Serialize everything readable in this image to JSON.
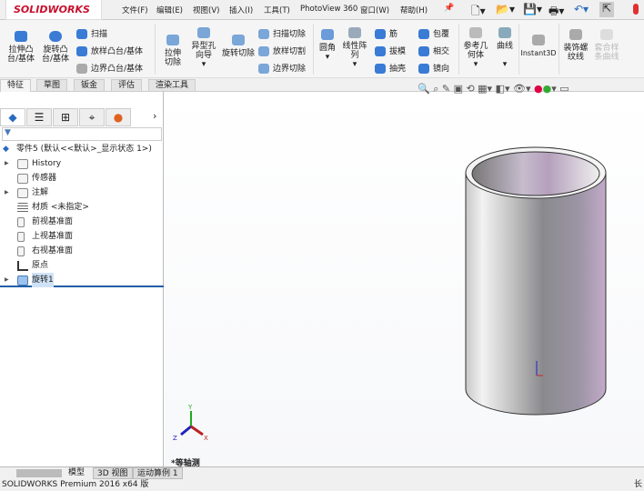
{
  "app": {
    "logo": "SOLIDWORKS"
  },
  "menu": [
    "文件(F)",
    "编辑(E)",
    "视图(V)",
    "插入(I)",
    "工具(T)",
    "PhotoView 360",
    "窗口(W)",
    "帮助(H)"
  ],
  "toolbar": {
    "extrude_boss": "拉伸凸台/基体",
    "revolve_boss": "旋转凸台/基体",
    "sweep": "扫描",
    "loft_boss": "放样凸台/基体",
    "boundary_boss": "边界凸台/基体",
    "extrude_cut": "拉伸切除",
    "hole_wizard": "异型孔向导",
    "revolve_cut": "旋转切除",
    "sweep_cut": "扫描切除",
    "loft_cut": "放样切割",
    "boundary_cut": "边界切除",
    "fillet": "圆角",
    "linear_pattern": "线性阵列",
    "rib": "筋",
    "draft": "拔模",
    "shell": "抽壳",
    "wrap": "包覆",
    "intersect": "相交",
    "mirror": "镜向",
    "ref_geometry": "参考几何体",
    "curves": "曲线",
    "instant3d": "Instant3D",
    "cosmetic_thread": "装饰螺纹线",
    "spline": "套合样条曲线"
  },
  "tabs": [
    "特征",
    "草图",
    "钣金",
    "评估",
    "渲染工具"
  ],
  "tree": {
    "root": "零件5 (默认<<默认>_显示状态 1>)",
    "items": [
      "History",
      "传感器",
      "注解",
      "材质 <未指定>",
      "前视基准面",
      "上视基准面",
      "右视基准面",
      "原点",
      "旋转1"
    ]
  },
  "viewport": {
    "view_label": "*等轴测",
    "triad": {
      "x": "X",
      "y": "Y",
      "z": "Z"
    }
  },
  "bottom_tabs": [
    "模型",
    "3D 视图",
    "运动算例 1"
  ],
  "status": {
    "text": "SOLIDWORKS Premium 2016 x64 版",
    "right": "长"
  },
  "colors": {
    "brand": "#c8102e",
    "selection": "#1f5fa8"
  }
}
